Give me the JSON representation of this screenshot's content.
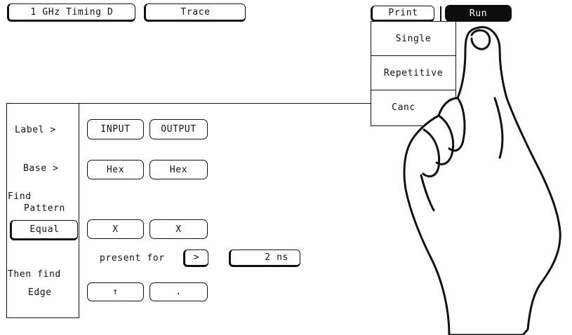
{
  "top_bar": {
    "module_label": "1 GHz Timing D",
    "menu_label": "Trace",
    "print_label": "Print",
    "run_label": "Run"
  },
  "run_menu": {
    "items": [
      "Single",
      "Repetitive",
      "Canc"
    ]
  },
  "trace_spec": {
    "label_row": {
      "title": "Label >",
      "values": [
        "INPUT",
        "OUTPUT"
      ]
    },
    "base_row": {
      "title": "Base >",
      "values": [
        "Hex",
        "Hex"
      ]
    },
    "find_title_line1": "Find",
    "find_title_line2": "Pattern",
    "pattern_mode": "Equal",
    "pattern_values": [
      "X",
      "X"
    ],
    "present_for_label": "present for",
    "duration_operator": ">",
    "duration_value": "2 ns",
    "then_find_label": "Then find",
    "edge_title": "Edge",
    "edge_values": [
      "↑",
      "."
    ]
  },
  "overlay": {
    "pointing_hand_icon": "pointing-hand-icon"
  },
  "colors": {
    "ink": "#111111",
    "background": "#ffffff",
    "run_fill": "#0d0d0d",
    "run_text": "#ffffff"
  }
}
